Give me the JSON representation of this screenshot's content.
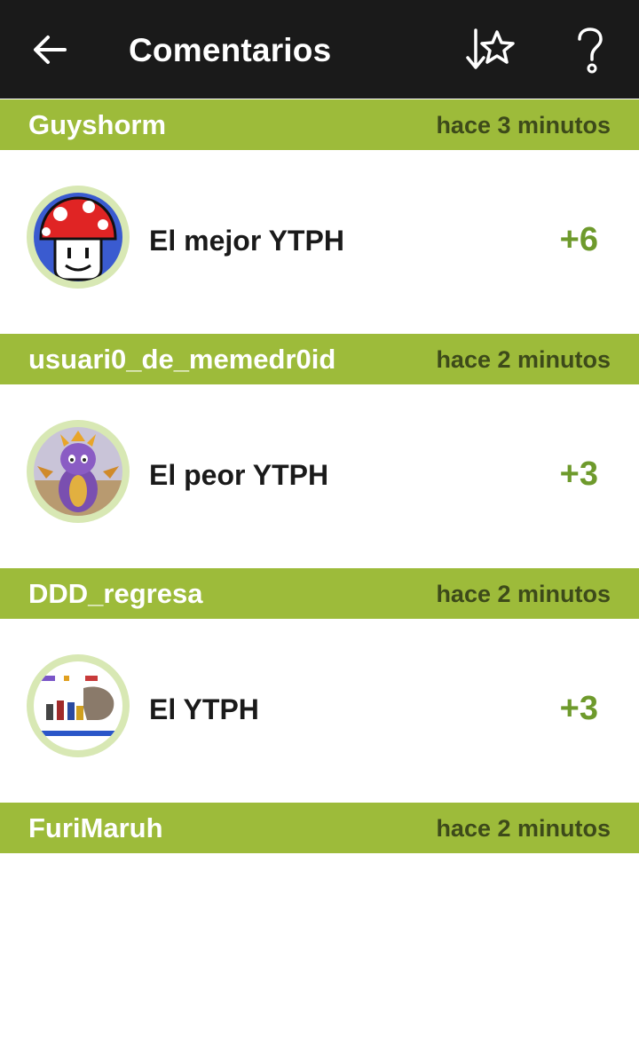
{
  "toolbar": {
    "title": "Comentarios",
    "back_icon": "arrow-left-icon",
    "sort_icon": "star-sort-icon",
    "help_icon": "help-question-icon"
  },
  "colors": {
    "toolbar_bg": "#1a1a1a",
    "header_bg": "#9dbb3a",
    "score_color": "#6e9a2c",
    "time_color": "#3d4a1a"
  },
  "comments": [
    {
      "username": "Guyshorm",
      "time": "hace 3 minutos",
      "text": "El mejor YTPH",
      "score": "+6",
      "avatar": "mushroom-avatar"
    },
    {
      "username": "usuari0_de_memedr0id",
      "time": "hace 2 minutos",
      "text": "El peor YTPH",
      "score": "+3",
      "avatar": "purple-dragon-avatar"
    },
    {
      "username": "DDD_regresa",
      "time": "hace 2 minutos",
      "text": "El YTPH",
      "score": "+3",
      "avatar": "internet-squad-avatar"
    },
    {
      "username": "FuriMaruh",
      "time": "hace 2 minutos",
      "text": "",
      "score": "",
      "avatar": ""
    }
  ]
}
